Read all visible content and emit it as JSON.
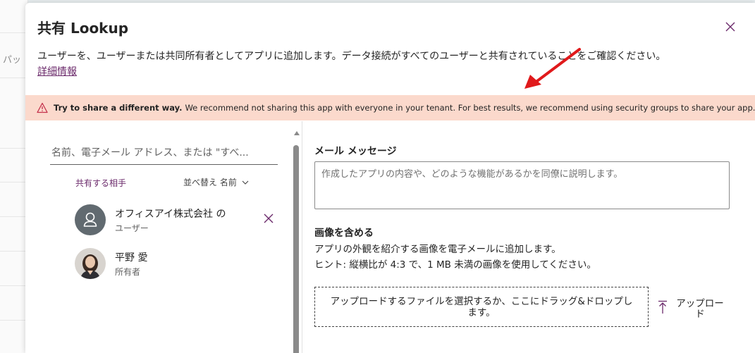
{
  "background": {
    "partial_text": "パッ"
  },
  "dialog": {
    "title": "共有 Lookup",
    "description": "ユーザーを、ユーザーまたは共同所有者としてアプリに追加します。データ接続がすべてのユーザーと共有されていることをご確認ください。",
    "more_info_link": "詳細情報"
  },
  "warning": {
    "bold": "Try to share a different way.",
    "text": "We recommend not sharing this app with everyone in your tenant. For best results, we recommend using security groups to share your app.",
    "icon": "warning-triangle-icon"
  },
  "left_panel": {
    "search_placeholder": "名前、電子メール アドレス、または \"すべ...",
    "share_with_label": "共有する相手",
    "sort_label": "並べ替え 名前",
    "people": [
      {
        "name": "オフィスアイ株式会社 の",
        "role": "ユーザー",
        "avatar": "person-icon"
      },
      {
        "name": "平野 愛",
        "role": "所有者",
        "avatar": "photo"
      }
    ]
  },
  "right_panel": {
    "email_label": "メール メッセージ",
    "email_placeholder": "作成したアプリの内容や、どのような機能があるかを同僚に説明します。",
    "image_label": "画像を含める",
    "image_desc": "アプリの外観を紹介する画像を電子メールに追加します。",
    "image_hint": "ヒント: 縦横比が 4:3 で、1 MB 未満の画像を使用してください。",
    "dropzone_text": "アップロードするファイルを選択するか、ここにドラッグ&ドロップします。",
    "upload_label": "アップロード"
  },
  "colors": {
    "accent": "#6b2a6b",
    "warning_bg": "#fbd9cc",
    "warning_icon": "#c4314b",
    "arrow": "#e0191b"
  }
}
